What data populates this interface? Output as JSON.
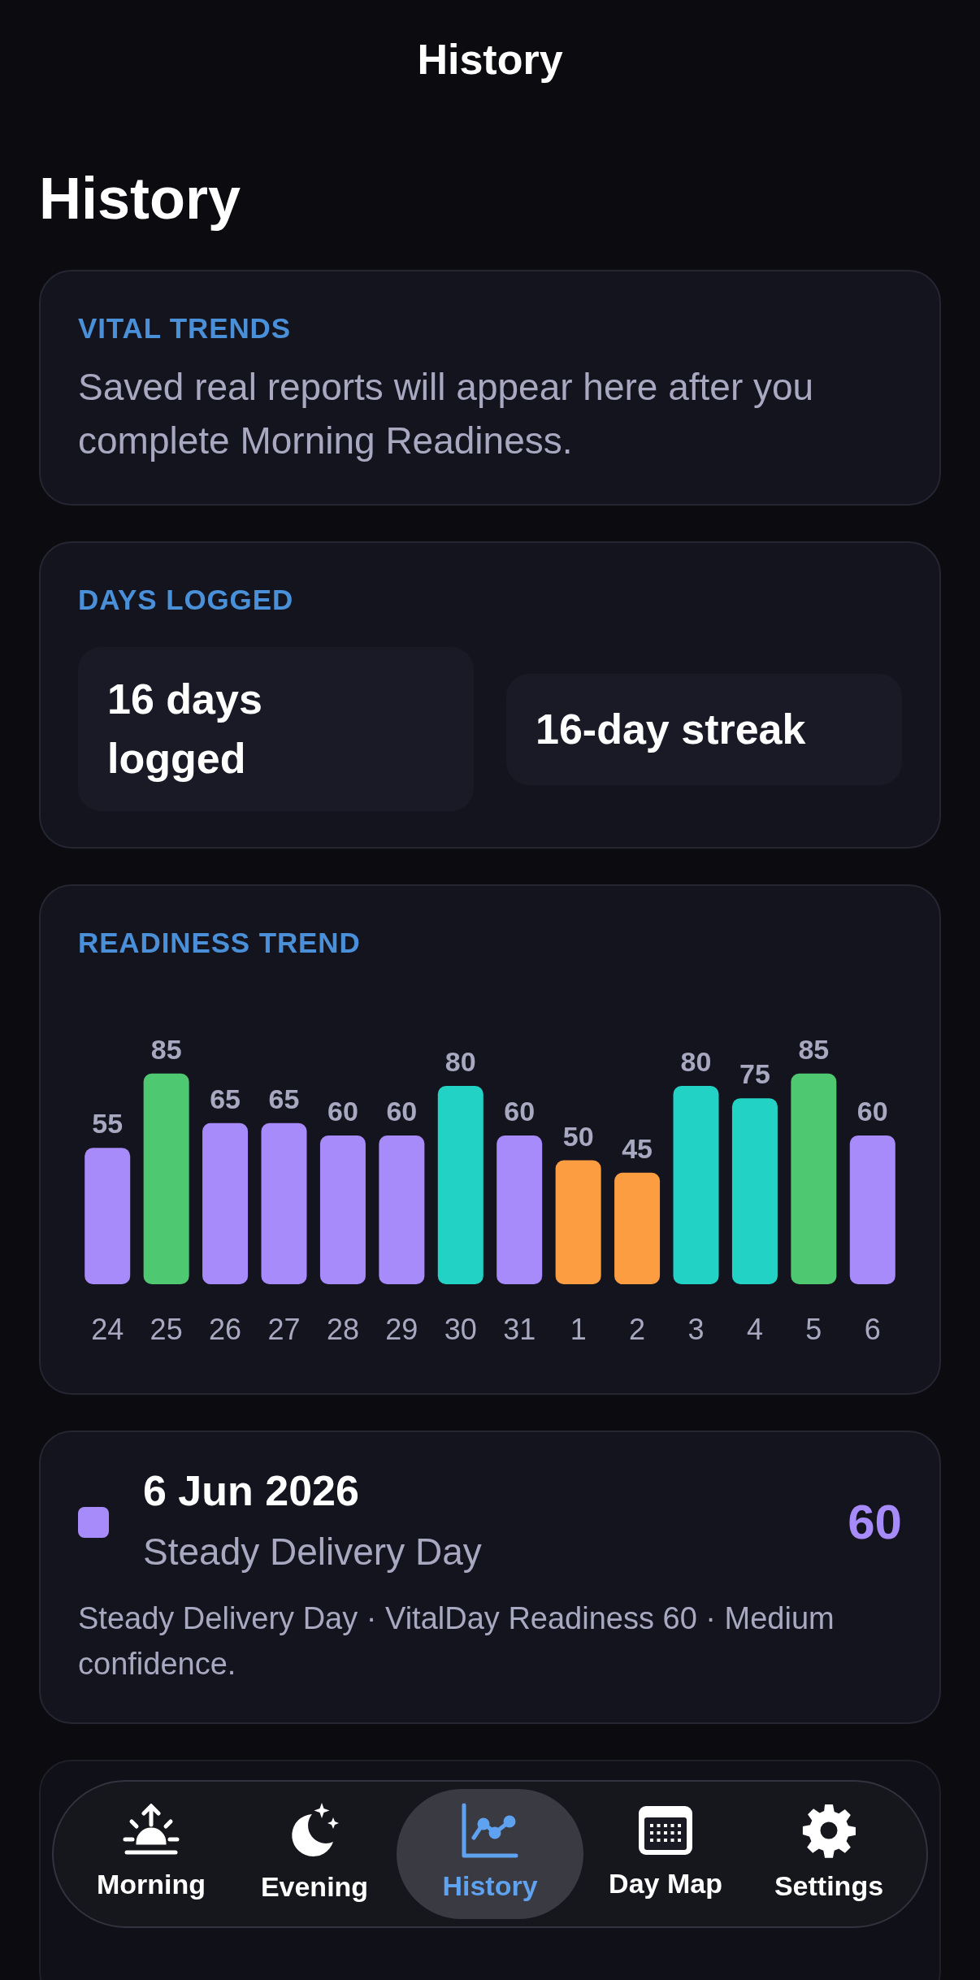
{
  "nav_title": "History",
  "heading": "History",
  "cards": [
    {
      "kind": "message",
      "label": "VITAL TRENDS",
      "text": "Saved real reports will appear here after you complete Morning Readiness."
    },
    {
      "kind": "stats",
      "label": "DAYS LOGGED",
      "stats": [
        "16 days logged",
        "16-day streak"
      ]
    },
    {
      "kind": "chart",
      "label": "READINESS TREND",
      "chart_data": {
        "type": "bar",
        "categories": [
          "24",
          "25",
          "26",
          "27",
          "28",
          "29",
          "30",
          "31",
          "1",
          "2",
          "3",
          "4",
          "5",
          "6"
        ],
        "data_labels": true,
        "series": [
          {
            "color": "#a78bfa",
            "values": [
              55,
              null,
              65,
              65,
              60,
              60,
              null,
              60,
              null,
              null,
              null,
              null,
              null,
              60
            ]
          },
          {
            "color": "#4fc872",
            "values": [
              null,
              85,
              null,
              null,
              null,
              null,
              null,
              null,
              null,
              null,
              null,
              null,
              85,
              null
            ]
          },
          {
            "color": "#22d3c5",
            "values": [
              null,
              null,
              null,
              null,
              null,
              null,
              80,
              null,
              null,
              null,
              80,
              75,
              null,
              null
            ]
          },
          {
            "color": "#fb9d40",
            "values": [
              null,
              null,
              null,
              null,
              null,
              null,
              null,
              null,
              50,
              45,
              null,
              null,
              null,
              null
            ]
          }
        ]
      }
    }
  ],
  "entries": [
    {
      "date": "6 Jun 2026",
      "title": "Steady Delivery Day",
      "score": "60",
      "color": "#a78bfa",
      "summary": "Steady Delivery Day · VitalDay Readiness 60 · Medium confidence."
    }
  ],
  "tabs": [
    {
      "label": "Morning",
      "selected": false
    },
    {
      "label": "Evening",
      "selected": false
    },
    {
      "label": "History",
      "selected": true
    },
    {
      "label": "Day Map",
      "selected": false
    },
    {
      "label": "Settings",
      "selected": false
    }
  ]
}
